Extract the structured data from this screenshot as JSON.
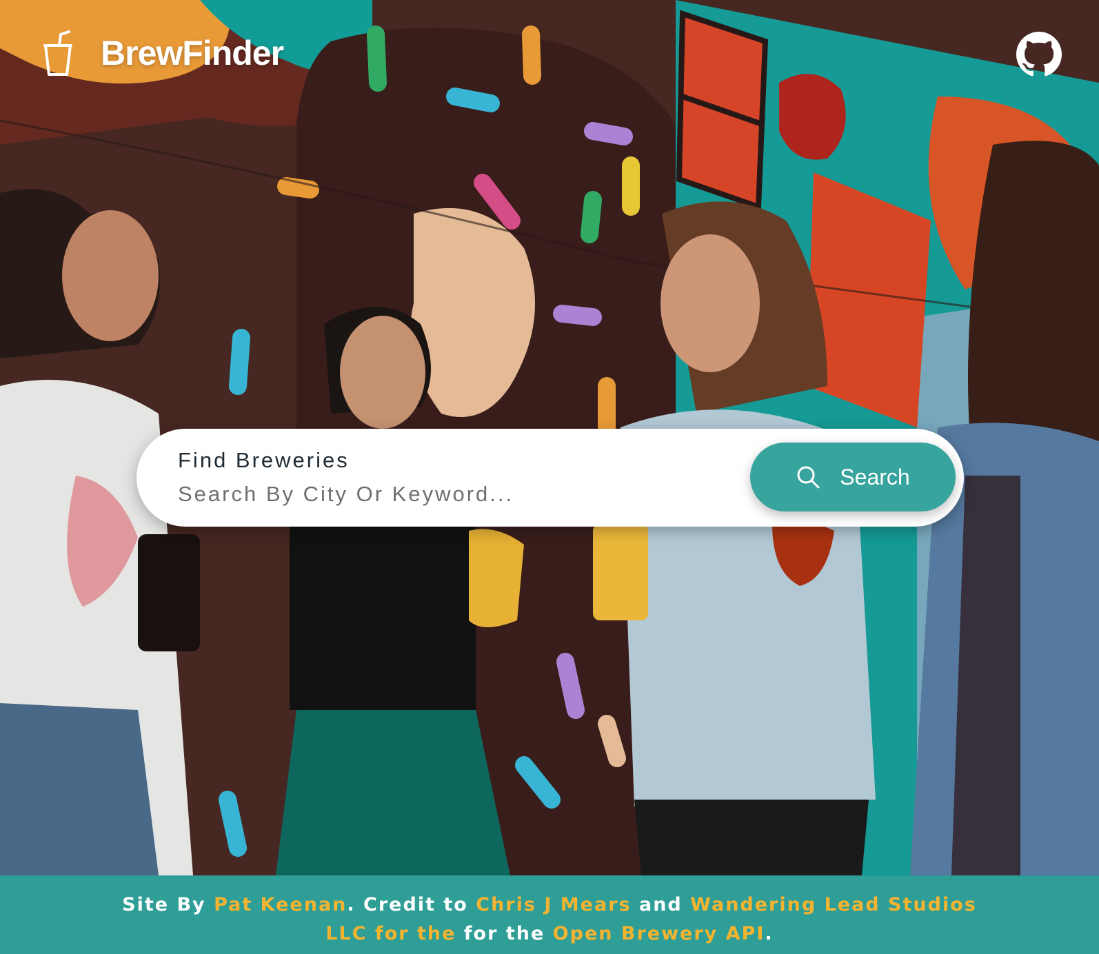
{
  "header": {
    "brand_name": "BrewFinder",
    "brand_icon": "cup-with-straw-icon",
    "github_icon": "github-icon"
  },
  "search": {
    "label": "Find Breweries",
    "value": "",
    "placeholder": "Search By City Or Keyword...",
    "button_label": "Search",
    "button_icon": "search-icon"
  },
  "footer": {
    "prefix": "Site By",
    "author": "Pat Keenan",
    "credit_text": ". Credit to",
    "credit_person": "Chris J Mears",
    "and_text": "and",
    "credit_studio": "Wandering Lead Studios LLC for the",
    "for_text": "for the",
    "api_name": "Open Brewery API",
    "suffix": "."
  },
  "colors": {
    "accent": "#37a49e",
    "footer_bg": "#2e9e97",
    "link": "#f5b32f",
    "text_dark": "#1f2a33"
  }
}
